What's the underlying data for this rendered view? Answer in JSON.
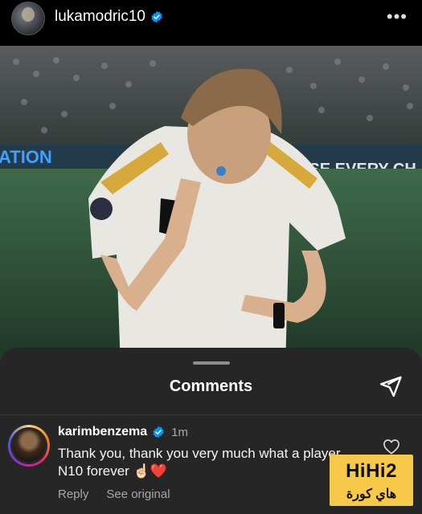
{
  "header": {
    "username": "lukamodric10",
    "more_icon": "more-horizontal-icon"
  },
  "post_image": {
    "banner_left": "ATION",
    "banner_right": "USE EVERY CH"
  },
  "comments_sheet": {
    "title": "Comments",
    "send_icon": "paper-plane-icon",
    "comment": {
      "username": "karimbenzema",
      "time": "1m",
      "text": "Thank you, thank you very much what a player N10 forever ☝🏻❤️",
      "reply_label": "Reply",
      "see_original_label": "See original"
    }
  },
  "watermark": {
    "top": "HiHi2",
    "bottom": "هاي كورة"
  },
  "colors": {
    "verified": "#0095f6",
    "sheet_bg": "#262626",
    "watermark": "#f7c948"
  }
}
